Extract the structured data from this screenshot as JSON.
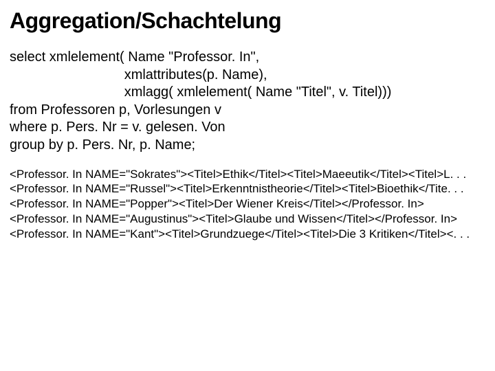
{
  "title": "Aggregation/Schachtelung",
  "sql": {
    "line1": "select xmlelement( Name \"Professor. In\",",
    "line2": "                              xmlattributes(p. Name),",
    "line3": "                              xmlagg( xmlelement( Name \"Titel\", v. Titel)))",
    "line4": "from Professoren p, Vorlesungen v",
    "line5": "where p. Pers. Nr = v. gelesen. Von",
    "line6": "group by p. Pers. Nr, p. Name;"
  },
  "output": {
    "line1": "<Professor. In NAME=\"Sokrates\"><Titel>Ethik</Titel><Titel>Maeeutik</Titel><Titel>L. . .",
    "line2": "<Professor. In NAME=\"Russel\"><Titel>Erkenntnistheorie</Titel><Titel>Bioethik</Tite. . .",
    "line3": "<Professor. In NAME=\"Popper\"><Titel>Der Wiener Kreis</Titel></Professor. In>",
    "line4": "<Professor. In NAME=\"Augustinus\"><Titel>Glaube und Wissen</Titel></Professor. In>",
    "line5": "<Professor. In NAME=\"Kant\"><Titel>Grundzuege</Titel><Titel>Die 3 Kritiken</Titel><. . ."
  }
}
